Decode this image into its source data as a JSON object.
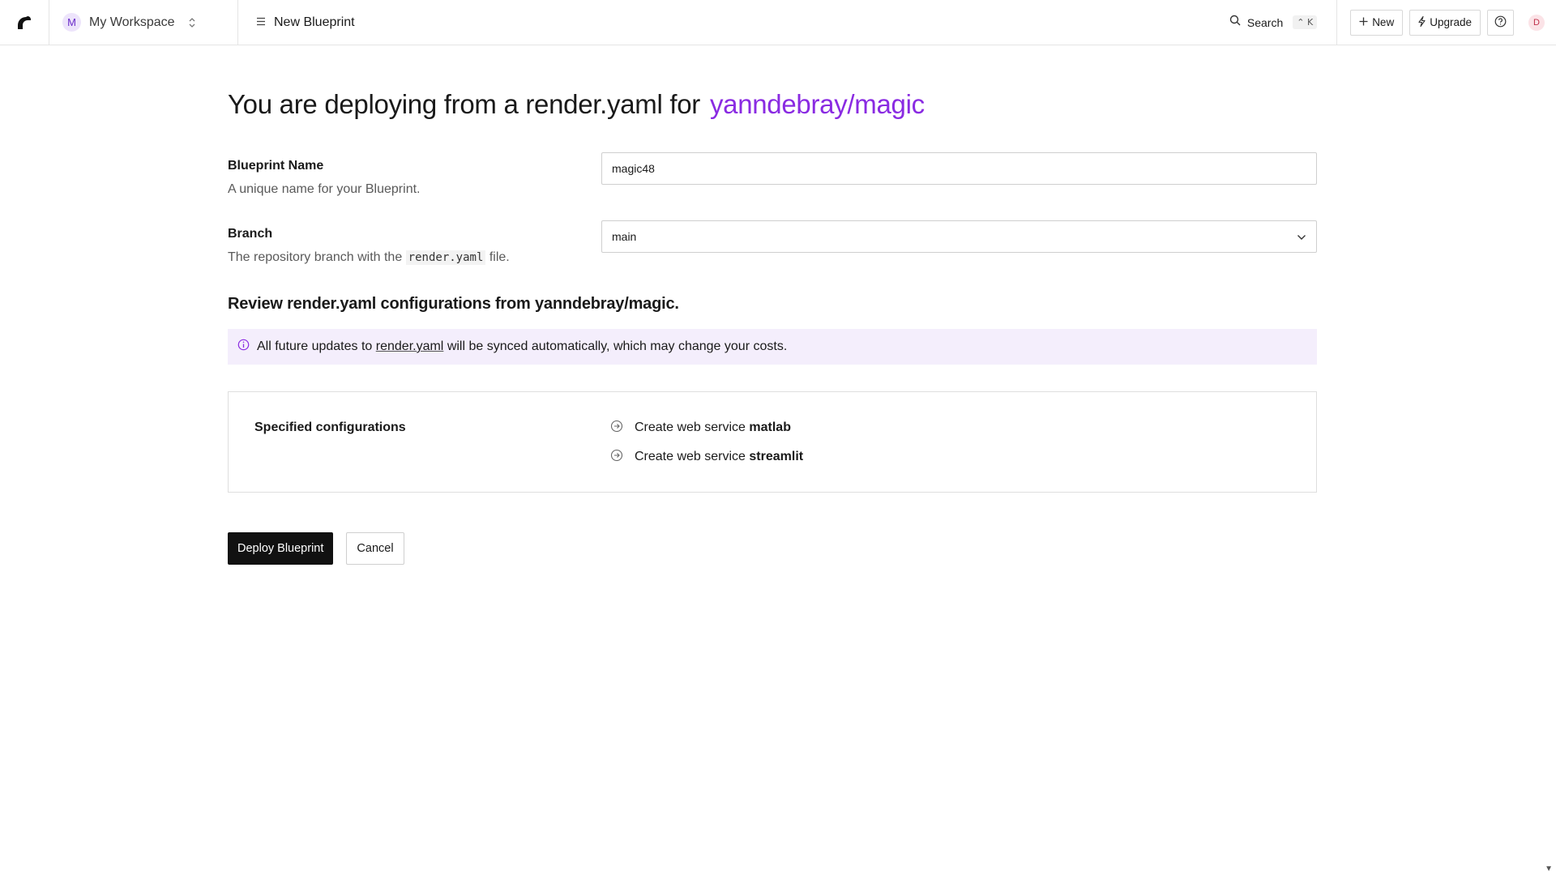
{
  "topbar": {
    "workspace": {
      "initial": "M",
      "name": "My Workspace"
    },
    "breadcrumb": "New Blueprint",
    "search": {
      "label": "Search",
      "shortcut": "⌃ K"
    },
    "buttons": {
      "new": "New",
      "upgrade": "Upgrade"
    },
    "user_initial": "D"
  },
  "page": {
    "title_prefix": "You are deploying from a render.yaml for",
    "repo": "yanndebray/magic"
  },
  "form": {
    "blueprint_name": {
      "label": "Blueprint Name",
      "help": "A unique name for your Blueprint.",
      "value": "magic48"
    },
    "branch": {
      "label": "Branch",
      "help_before": "The repository branch with the",
      "help_code": "render.yaml",
      "help_after": "file.",
      "value": "main"
    }
  },
  "review": {
    "title": "Review render.yaml configurations from yanndebray/magic.",
    "notice_before": "All future updates to",
    "notice_link": "render.yaml",
    "notice_after": "will be synced automatically, which may change your costs.",
    "config_label": "Specified configurations",
    "items": [
      {
        "prefix": "Create web service",
        "name": "matlab"
      },
      {
        "prefix": "Create web service",
        "name": "streamlit"
      }
    ]
  },
  "actions": {
    "deploy": "Deploy Blueprint",
    "cancel": "Cancel"
  },
  "colors": {
    "accent": "#8a2be2",
    "notice_bg": "#f4eefc",
    "primary_button": "#111111"
  }
}
